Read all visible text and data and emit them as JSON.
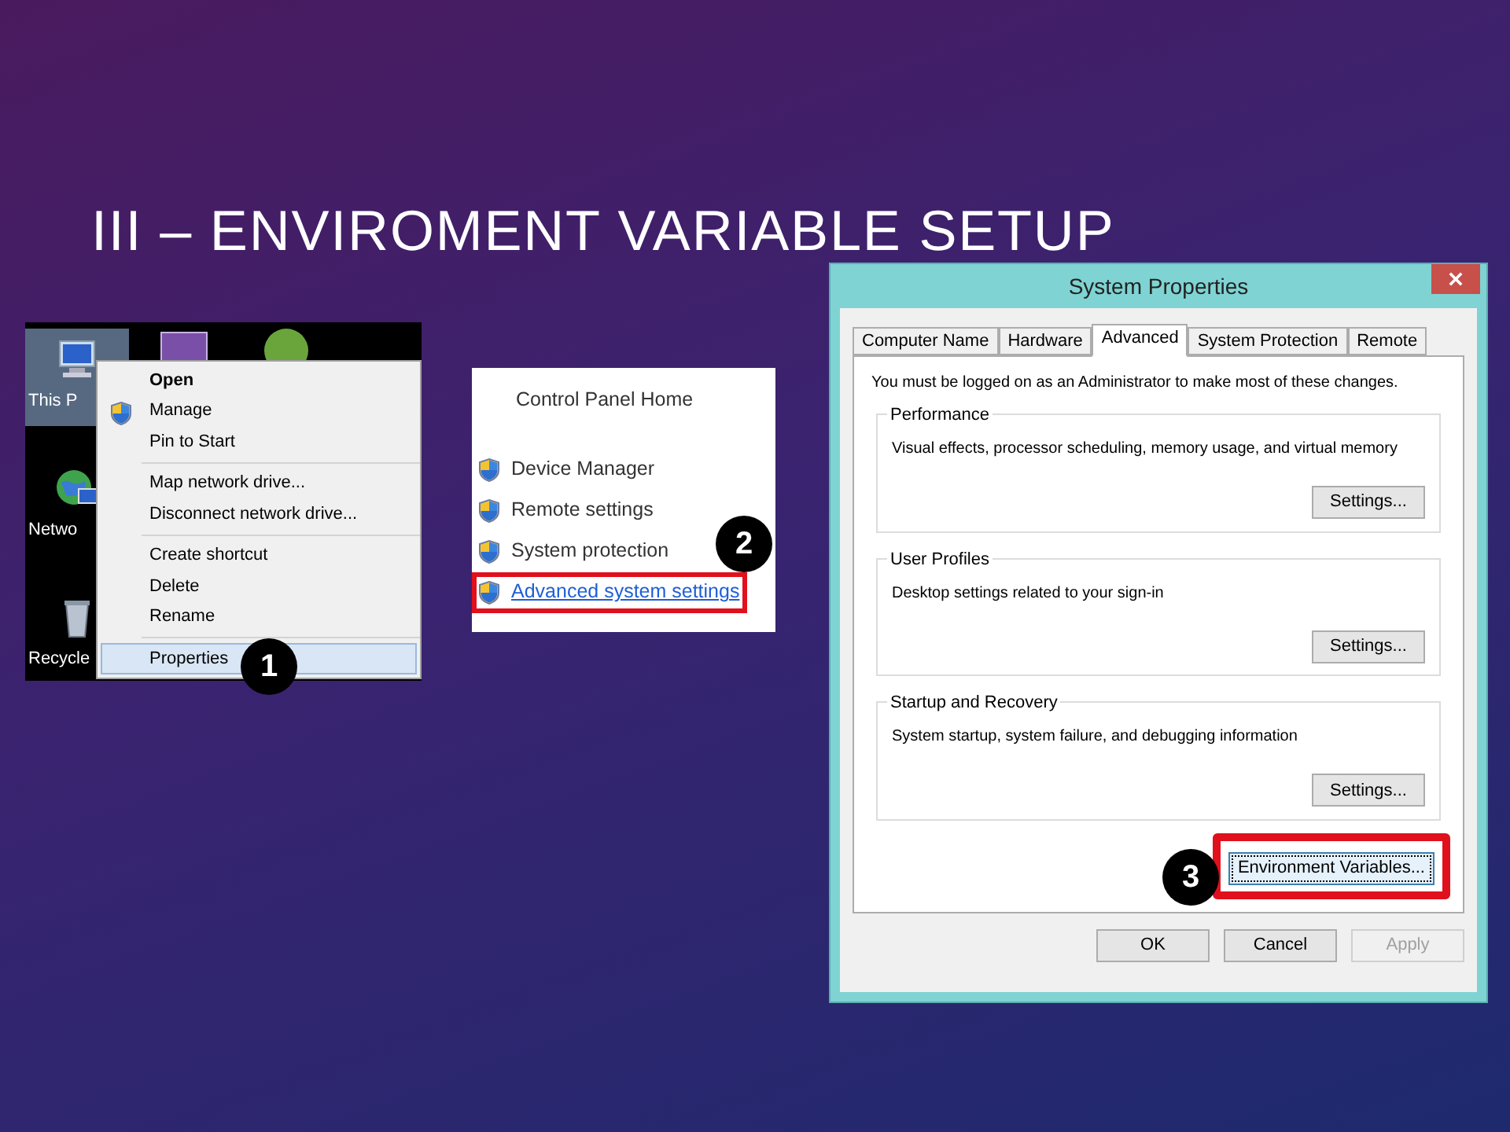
{
  "slide": {
    "title": "III – ENVIROMENT VARIABLE SETUP"
  },
  "step1": {
    "badge": "1",
    "desktop_icons": [
      {
        "label": "This P",
        "kind": "computer",
        "selected": true
      },
      {
        "label": "Netwo",
        "kind": "network",
        "selected": false
      },
      {
        "label": "Recycle",
        "kind": "bin",
        "selected": false
      }
    ],
    "menu_sections": [
      [
        {
          "label": "Open",
          "default": true,
          "shield": false,
          "selected": false
        },
        {
          "label": "Manage",
          "default": false,
          "shield": true,
          "selected": false
        },
        {
          "label": "Pin to Start",
          "default": false,
          "shield": false,
          "selected": false
        }
      ],
      [
        {
          "label": "Map network drive...",
          "default": false,
          "shield": false,
          "selected": false
        },
        {
          "label": "Disconnect network drive...",
          "default": false,
          "shield": false,
          "selected": false
        }
      ],
      [
        {
          "label": "Create shortcut",
          "default": false,
          "shield": false,
          "selected": false
        },
        {
          "label": "Delete",
          "default": false,
          "shield": false,
          "selected": false
        },
        {
          "label": "Rename",
          "default": false,
          "shield": false,
          "selected": false
        }
      ],
      [
        {
          "label": "Properties",
          "default": false,
          "shield": false,
          "selected": true
        }
      ]
    ]
  },
  "step2": {
    "badge": "2",
    "home": "Control Panel Home",
    "links": [
      {
        "label": "Device Manager",
        "highlighted": false
      },
      {
        "label": "Remote settings",
        "highlighted": false
      },
      {
        "label": "System protection",
        "highlighted": false
      },
      {
        "label": "Advanced system settings",
        "highlighted": true
      }
    ]
  },
  "step3": {
    "badge": "3",
    "window_title": "System Properties",
    "tabs": [
      {
        "label": "Computer Name",
        "selected": false
      },
      {
        "label": "Hardware",
        "selected": false
      },
      {
        "label": "Advanced",
        "selected": true
      },
      {
        "label": "System Protection",
        "selected": false
      },
      {
        "label": "Remote",
        "selected": false
      }
    ],
    "notice": "You must be logged on as an Administrator to make most of these changes.",
    "groups": [
      {
        "title": "Performance",
        "description": "Visual effects, processor scheduling, memory usage, and virtual memory",
        "button": "Settings..."
      },
      {
        "title": "User Profiles",
        "description": "Desktop settings related to your sign-in",
        "button": "Settings..."
      },
      {
        "title": "Startup and Recovery",
        "description": "System startup, system failure, and debugging information",
        "button": "Settings..."
      }
    ],
    "env_button": {
      "label": "Environment Variables...",
      "highlighted": true
    },
    "footer_buttons": [
      {
        "label": "OK",
        "disabled": false
      },
      {
        "label": "Cancel",
        "disabled": false
      },
      {
        "label": "Apply",
        "disabled": true
      }
    ]
  }
}
